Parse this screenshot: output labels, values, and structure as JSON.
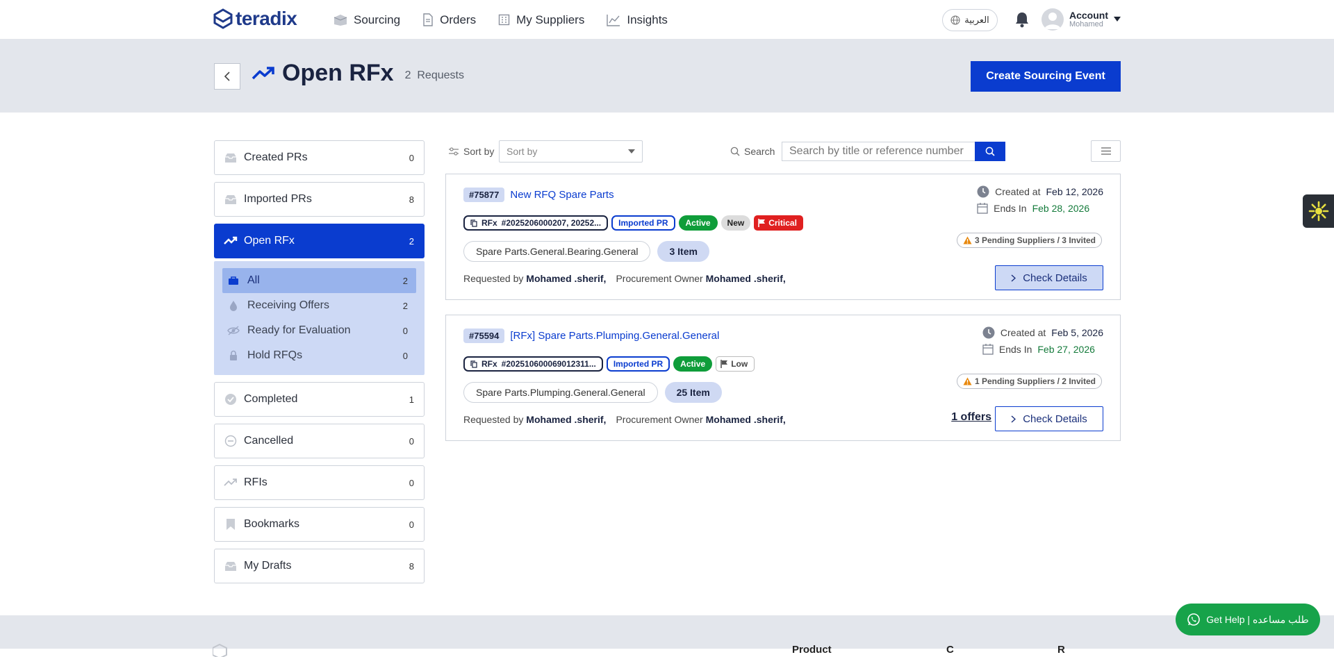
{
  "brand": {
    "name": "teradix",
    "color": "#0a3ccf"
  },
  "nav": {
    "items": [
      {
        "label": "Sourcing",
        "icon": "box-icon"
      },
      {
        "label": "Orders",
        "icon": "document-icon"
      },
      {
        "label": "My Suppliers",
        "icon": "building-icon"
      },
      {
        "label": "Insights",
        "icon": "chart-icon"
      }
    ],
    "language": "العربية",
    "account_label": "Account",
    "account_user": "Mohamed"
  },
  "page": {
    "title": "Open RFx",
    "count": "2",
    "count_label": "Requests",
    "create_button": "Create Sourcing Event"
  },
  "sidebar": {
    "items": [
      {
        "label": "Created PRs",
        "count": "0"
      },
      {
        "label": "Imported PRs",
        "count": "8"
      },
      {
        "label": "Open RFx",
        "count": "2",
        "active": true
      },
      {
        "label": "Completed",
        "count": "1"
      },
      {
        "label": "Cancelled",
        "count": "0"
      },
      {
        "label": "RFIs",
        "count": "0"
      },
      {
        "label": "Bookmarks",
        "count": "0"
      },
      {
        "label": "My Drafts",
        "count": "8"
      }
    ],
    "subitems": [
      {
        "label": "All",
        "count": "2",
        "selected": true
      },
      {
        "label": "Receiving Offers",
        "count": "2"
      },
      {
        "label": "Ready for Evaluation",
        "count": "0"
      },
      {
        "label": "Hold RFQs",
        "count": "0"
      }
    ]
  },
  "toolbar": {
    "sort_label": "Sort by",
    "sort_value": "Sort by",
    "search_label": "Search",
    "search_placeholder": "Search by title or reference number"
  },
  "cards": [
    {
      "ref": "#75877",
      "title": "New RFQ Spare Parts",
      "rfx_label": "RFx",
      "rfx_numbers": "#2025206000207, 20252...",
      "source": "Imported PR",
      "status": "Active",
      "extra_badge": "New",
      "priority": "Critical",
      "category": "Spare Parts.General.Bearing.General",
      "items": "3 Item",
      "requested_by_label": "Requested by",
      "requested_by": "Mohamed .sherif,",
      "owner_label": "Procurement Owner",
      "owner": "Mohamed .sherif,",
      "created_label": "Created at",
      "created": "Feb 12, 2026",
      "ends_label": "Ends In",
      "ends": "Feb 28, 2026",
      "pending": "3 Pending Suppliers / 3 Invited",
      "check_label": "Check Details"
    },
    {
      "ref": "#75594",
      "title": "[RFx] Spare Parts.Plumping.General.General",
      "rfx_label": "RFx",
      "rfx_numbers": "#202510600069012311...",
      "source": "Imported PR",
      "status": "Active",
      "priority": "Low",
      "category": "Spare Parts.Plumping.General.General",
      "items": "25 Item",
      "requested_by_label": "Requested by",
      "requested_by": "Mohamed .sherif,",
      "owner_label": "Procurement Owner",
      "owner": "Mohamed .sherif,",
      "created_label": "Created at",
      "created": "Feb 5, 2026",
      "ends_label": "Ends In",
      "ends": "Feb 27, 2026",
      "pending": "1 Pending Suppliers / 2 Invited",
      "offers": "1 offers",
      "check_label": "Check Details"
    }
  ],
  "help": {
    "label": "Get Help | طلب مساعده"
  },
  "footer": {
    "col1": "Product",
    "col2": "C",
    "col3": "R"
  }
}
